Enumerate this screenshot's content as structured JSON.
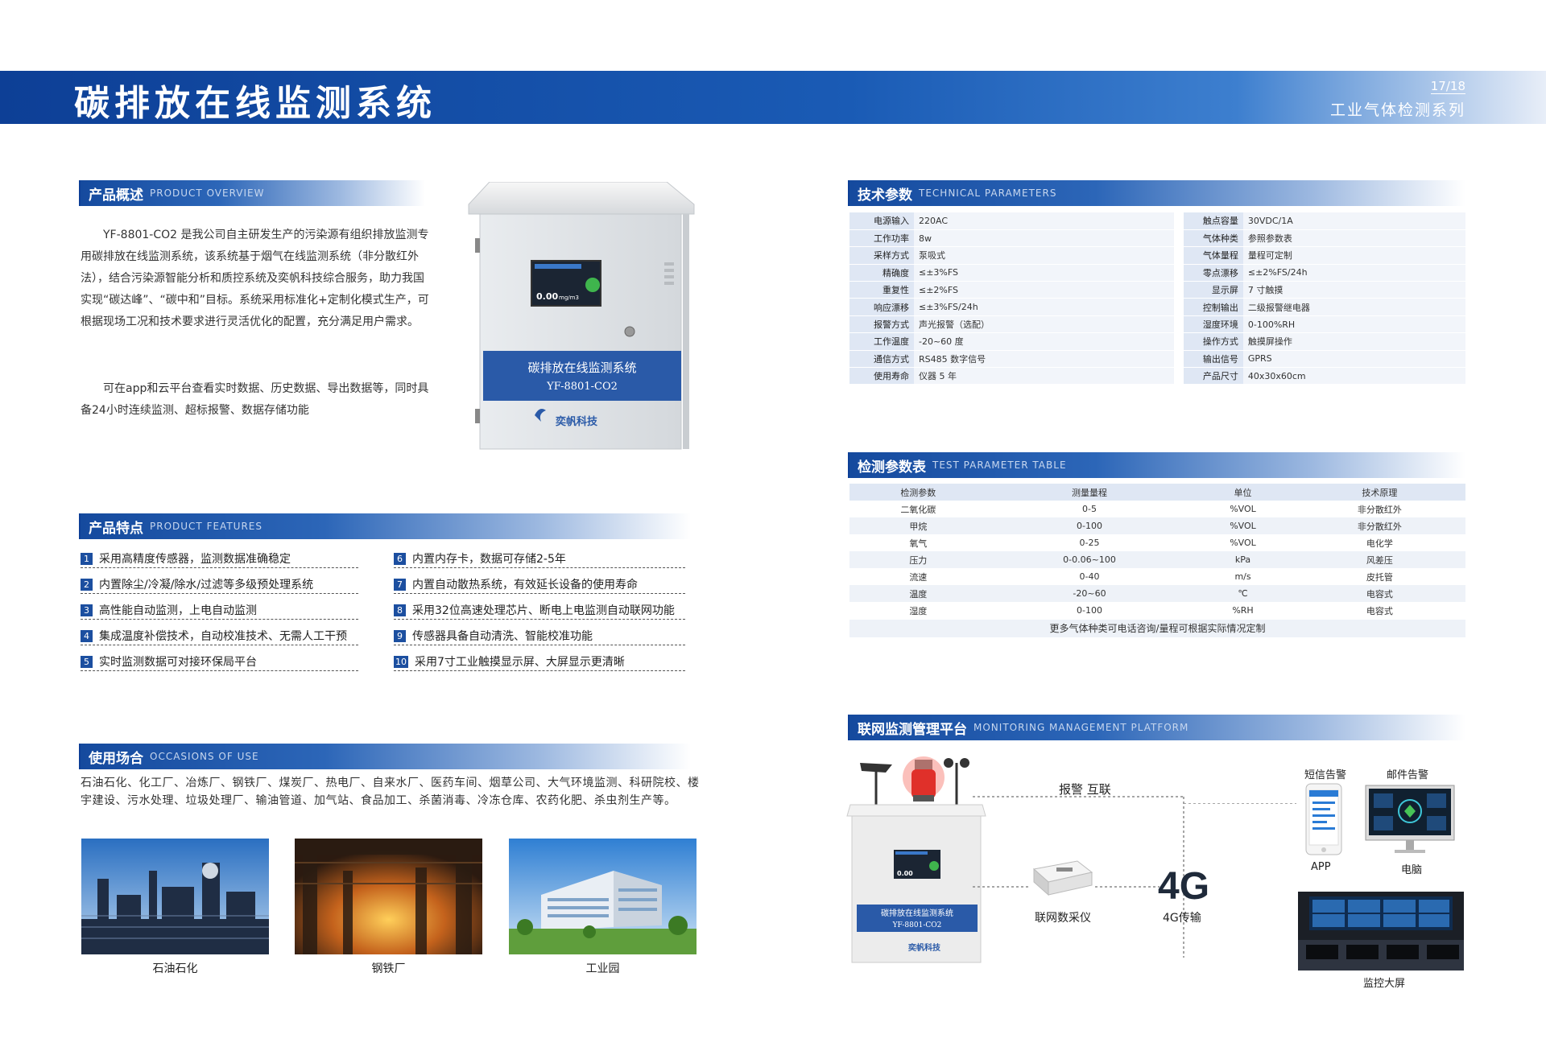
{
  "header": {
    "title": "碳排放在线监测系统",
    "page": "17/18",
    "series": "工业气体检测系列"
  },
  "overview": {
    "zh": "产品概述",
    "en": "PRODUCT OVERVIEW",
    "p1": "YF-8801-CO2 是我公司自主研发生产的污染源有组织排放监测专用碳排放在线监测系统，该系统基于烟气在线监测系统（非分散红外法），结合污染源智能分析和质控系统及奕帆科技综合服务，助力我国实现“碳达峰”、“碳中和”目标。系统采用标准化+定制化模式生产，可根据现场工况和技术要求进行灵活优化的配置，充分满足用户需求。",
    "p2": "可在app和云平台查看实时数据、历史数据、导出数据等，同时具备24小时连续监测、超标报警、数据存储功能"
  },
  "device": {
    "screen_value": "0.00",
    "screen_unit": "mg/m3",
    "panel_name": "碳排放在线监测系统",
    "panel_model": "YF-8801-CO2",
    "brand": "奕帆科技"
  },
  "features": {
    "zh": "产品特点",
    "en": "PRODUCT FEATURES",
    "left": [
      {
        "n": "1",
        "t": "采用高精度传感器，监测数据准确稳定"
      },
      {
        "n": "2",
        "t": "内置除尘/冷凝/除水/过滤等多级预处理系统"
      },
      {
        "n": "3",
        "t": "高性能自动监测，上电自动监测"
      },
      {
        "n": "4",
        "t": "集成温度补偿技术，自动校准技术、无需人工干预"
      },
      {
        "n": "5",
        "t": "实时监测数据可对接环保局平台"
      }
    ],
    "right": [
      {
        "n": "6",
        "t": "内置内存卡，数据可存储2-5年"
      },
      {
        "n": "7",
        "t": "内置自动散热系统，有效延长设备的使用寿命"
      },
      {
        "n": "8",
        "t": "采用32位高速处理芯片、断电上电监测自动联网功能"
      },
      {
        "n": "9",
        "t": "传感器具备自动清洗、智能校准功能"
      },
      {
        "n": "10",
        "t": "采用7寸工业触摸显示屏、大屏显示更清晰"
      }
    ]
  },
  "usage": {
    "zh": "使用场合",
    "en": "OCCASIONS OF USE",
    "text": "石油石化、化工厂、冶炼厂、钢铁厂、煤炭厂、热电厂、自来水厂、医药车间、烟草公司、大气环境监测、科研院校、楼宇建设、污水处理、垃圾处理厂、输油管道、加气站、食品加工、杀菌消毒、冷冻仓库、农药化肥、杀虫剂生产等。",
    "images": [
      "石油石化",
      "钢铁厂",
      "工业园"
    ]
  },
  "tech": {
    "zh": "技术参数",
    "en": "TECHNICAL PARAMETERS",
    "rows": [
      [
        "电源输入",
        "220AC",
        "触点容量",
        "30VDC/1A"
      ],
      [
        "工作功率",
        "8w",
        "气体种类",
        "参照参数表"
      ],
      [
        "采样方式",
        "泵吸式",
        "气体量程",
        "量程可定制"
      ],
      [
        "精确度",
        "≤±3%FS",
        "零点漂移",
        "≤±2%FS/24h"
      ],
      [
        "重复性",
        "≤±2%FS",
        "显示屏",
        "7 寸触摸"
      ],
      [
        "响应漂移",
        "≤±3%FS/24h",
        "控制输出",
        "二级报警继电器"
      ],
      [
        "报警方式",
        "声光报警（选配）",
        "湿度环境",
        "0-100%RH"
      ],
      [
        "工作温度",
        "-20~60 度",
        "操作方式",
        "触摸屏操作"
      ],
      [
        "通信方式",
        "RS485 数字信号",
        "输出信号",
        "GPRS"
      ],
      [
        "使用寿命",
        "仪器 5 年",
        "产品尺寸",
        "40x30x60cm"
      ]
    ]
  },
  "test": {
    "zh": "检测参数表",
    "en": "TEST PARAMETER TABLE",
    "headers": [
      "检测参数",
      "测量量程",
      "单位",
      "技术原理"
    ],
    "rows": [
      [
        "二氧化碳",
        "0-5",
        "%VOL",
        "非分散红外"
      ],
      [
        "甲烷",
        "0-100",
        "%VOL",
        "非分散红外"
      ],
      [
        "氧气",
        "0-25",
        "%VOL",
        "电化学"
      ],
      [
        "压力",
        "0-0.06~100",
        "kPa",
        "风差压"
      ],
      [
        "流速",
        "0-40",
        "m/s",
        "皮托管"
      ],
      [
        "温度",
        "-20~60",
        "℃",
        "电容式"
      ],
      [
        "湿度",
        "0-100",
        "%RH",
        "电容式"
      ]
    ],
    "note": "更多气体种类可电话咨询/量程可根据实际情况定制"
  },
  "platform": {
    "zh": "联网监测管理平台",
    "en": "MONITORING MANAGEMENT PLATFORM",
    "alarm": "报警 互联",
    "collector": "联网数采仪",
    "big4g": "4G",
    "trans": "4G传输",
    "sms": "短信告警",
    "mail": "邮件告警",
    "app": "APP",
    "pc": "电脑",
    "wall": "监控大屏",
    "panel_name": "碳排放在线监测系统",
    "panel_model": "YF-8801-CO2",
    "brand": "奕帆科技",
    "screen_value": "0.00"
  },
  "colors": {
    "brand_blue": "#1a4d9e",
    "panel_blue": "#2a5aa8"
  }
}
